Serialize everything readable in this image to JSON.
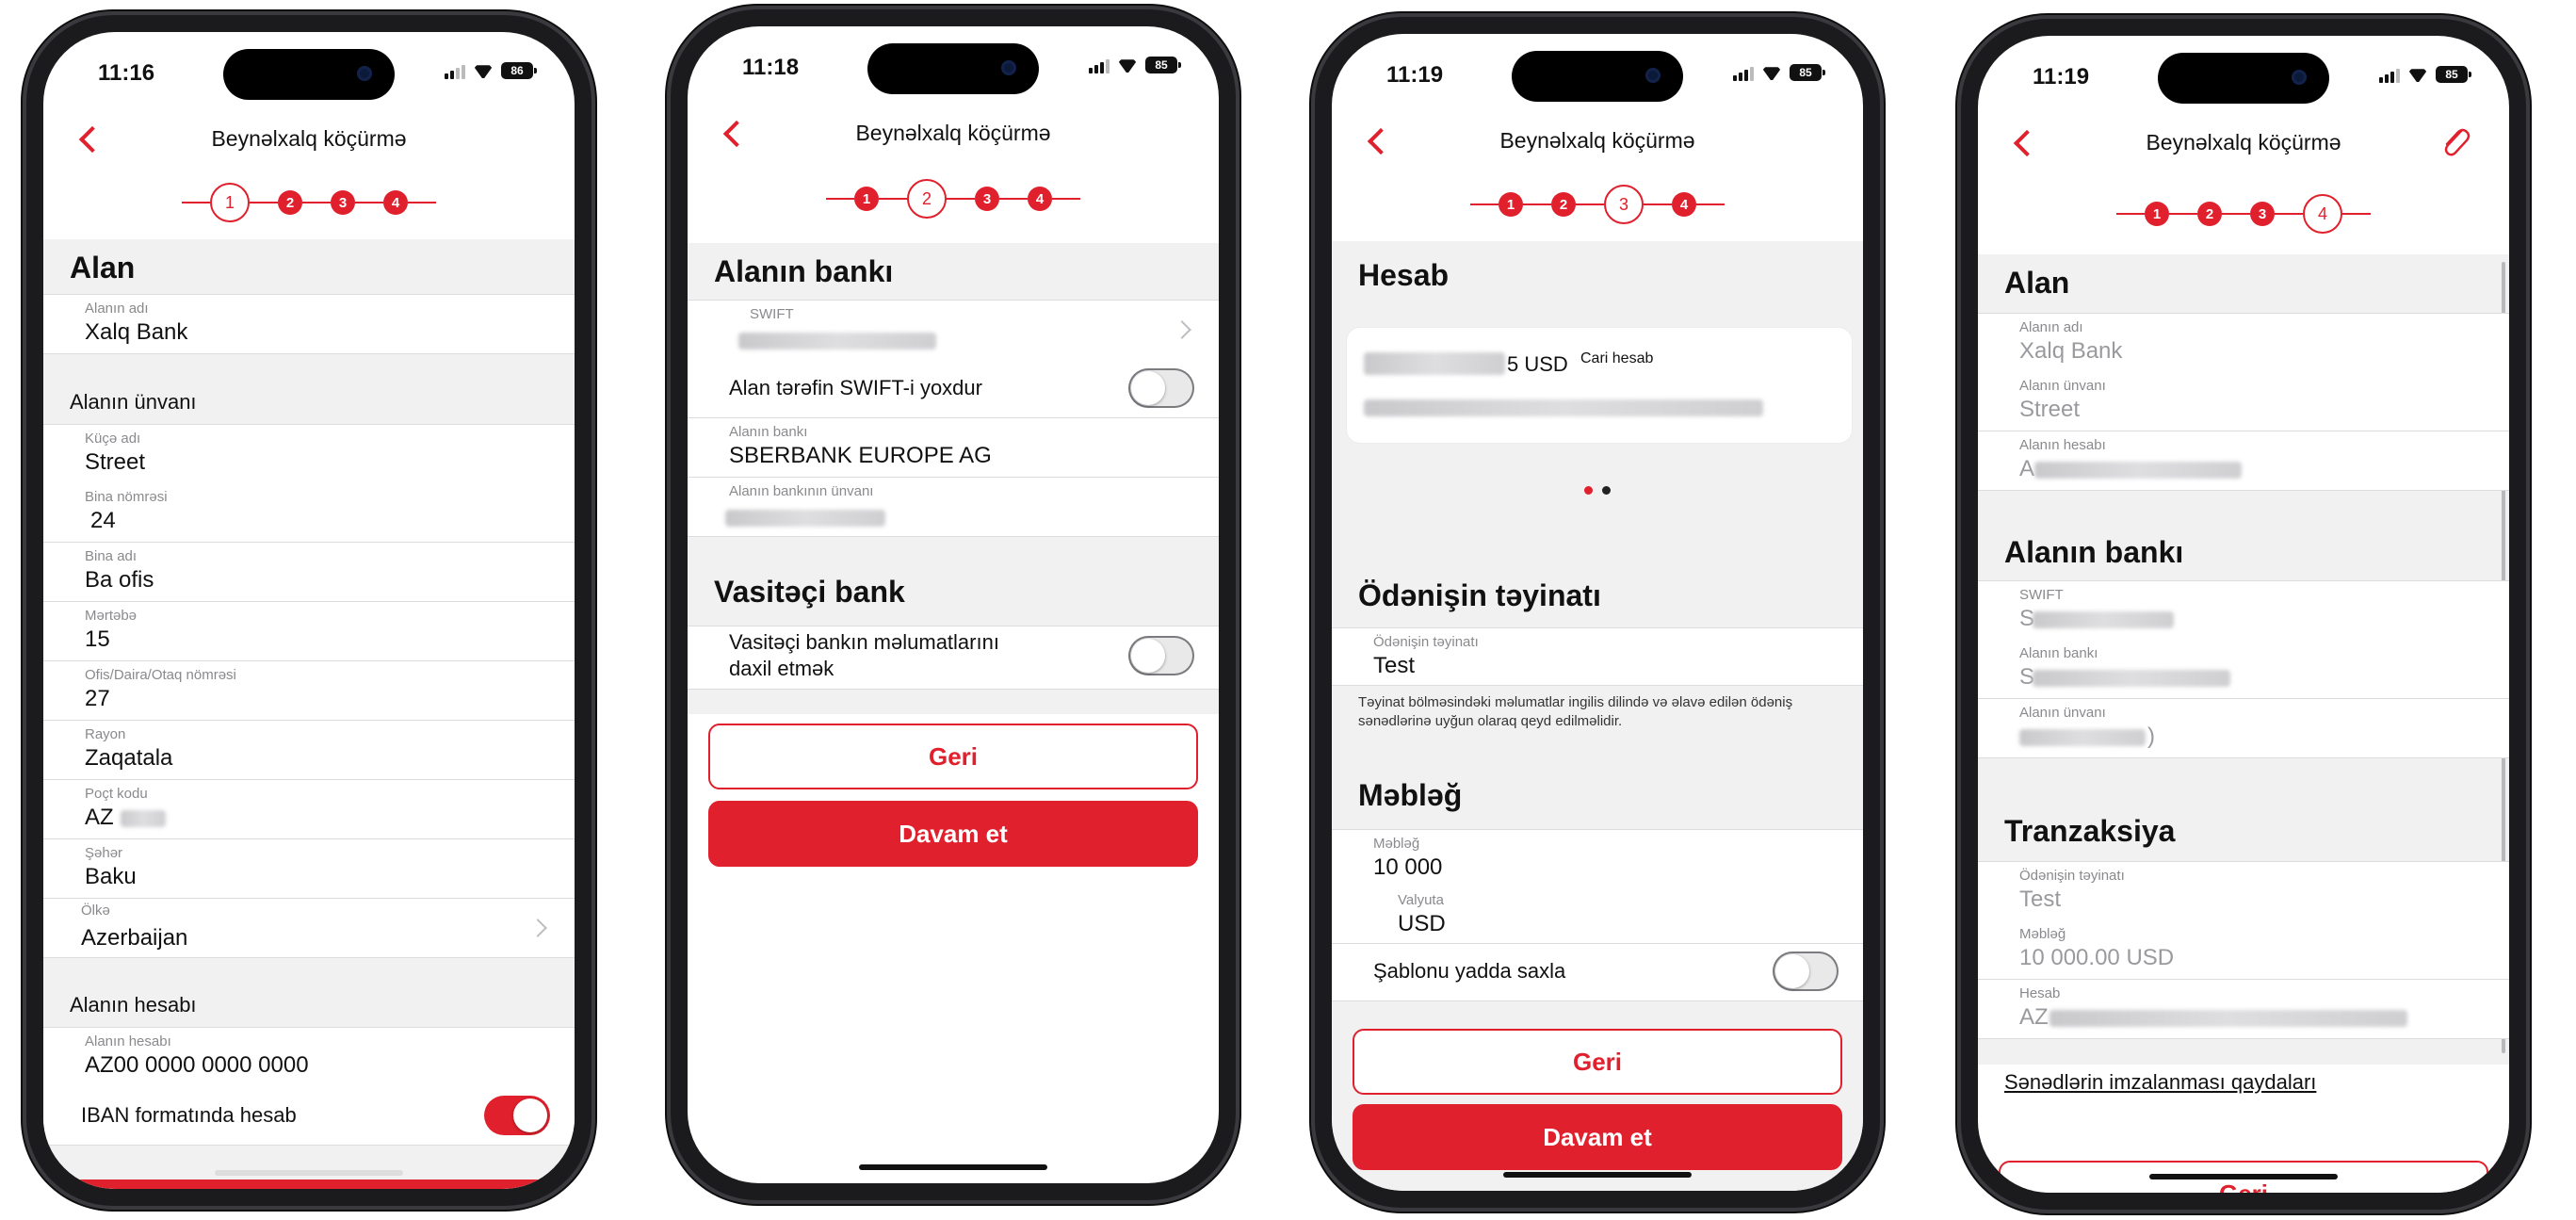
{
  "colors": {
    "accent": "#e0202c"
  },
  "phones": [
    {
      "status": {
        "time": "11:16",
        "battery": "86"
      },
      "nav": {
        "title": "Beynəlxalq köçürmə",
        "back_icon": "chevron-left-icon"
      },
      "steps": [
        "1",
        "2",
        "3",
        "4"
      ],
      "active_step": 1,
      "section_title": "Alan",
      "recipient_name": {
        "label": "Alanın adı",
        "value": "Xalq Bank"
      },
      "address_group": "Alanın ünvanı",
      "address_fields": [
        {
          "label": "Küçə adı",
          "value": "Street"
        },
        {
          "label": "Bina nömrəsi",
          "value": "24"
        },
        {
          "label": "Bina adı",
          "value": "Ba ofis"
        },
        {
          "label": "Mərtəbə",
          "value": "15"
        },
        {
          "label": "Ofis/Daira/Otaq nömrəsi",
          "value": "27"
        },
        {
          "label": "Rayon",
          "value": "Zaqatala"
        },
        {
          "label": "Poçt kodu",
          "value": "AZ"
        },
        {
          "label": "Şəhər",
          "value": "Baku"
        },
        {
          "label": "Ölkə",
          "value": "Azerbaijan"
        }
      ],
      "account_group": "Alanın hesabı",
      "account": {
        "label": "Alanın hesabı",
        "value": "AZ00 0000 0000 0000"
      },
      "iban_toggle": {
        "label": "IBAN formatında hesab",
        "on": true
      }
    },
    {
      "status": {
        "time": "11:18",
        "battery": "85"
      },
      "nav": {
        "title": "Beynəlxalq köçürmə",
        "back_icon": "chevron-left-icon"
      },
      "steps": [
        "1",
        "2",
        "3",
        "4"
      ],
      "active_step": 2,
      "bank_section": "Alanın bankı",
      "swift": {
        "label": "SWIFT"
      },
      "no_swift_toggle": {
        "label": "Alan tərəfin SWIFT-i yoxdur",
        "on": false
      },
      "bank_name": {
        "label": "Alanın bankı",
        "value": "SBERBANK EUROPE AG"
      },
      "bank_address": {
        "label": "Alanın bankının ünvanı"
      },
      "intermediary_section": "Vasitəçi bank",
      "intermediary_toggle": {
        "label_line1": "Vasitəçi bankın məlumatlarını",
        "label_line2": "daxil etmək",
        "on": false
      },
      "back_button": "Geri",
      "continue_button": "Davam et"
    },
    {
      "status": {
        "time": "11:19",
        "battery": "85"
      },
      "nav": {
        "title": "Beynəlxalq köçürmə",
        "back_icon": "chevron-left-icon"
      },
      "steps": [
        "1",
        "2",
        "3",
        "4"
      ],
      "active_step": 3,
      "account_section": "Hesab",
      "account_card": {
        "amount_suffix": "5 USD",
        "type": "Cari hesab"
      },
      "pager": {
        "count": 2,
        "active": 1
      },
      "purpose_section": "Ödənişin təyinatı",
      "purpose": {
        "label": "Ödənişin təyinatı",
        "value": "Test"
      },
      "purpose_note": "Təyinat bölməsindəki məlumatlar ingilis dilində və əlavə edilən ödəniş sənədlərinə uyğun olaraq qeyd edilməlidir.",
      "amount_section": "Məbləğ",
      "amount": {
        "label": "Məbləğ",
        "value": "10 000"
      },
      "currency": {
        "label": "Valyuta",
        "value": "USD"
      },
      "template_toggle": {
        "label": "Şablonu yadda saxla",
        "on": false
      },
      "back_button": "Geri",
      "continue_button": "Davam et"
    },
    {
      "status": {
        "time": "11:19",
        "battery": "85"
      },
      "nav": {
        "title": "Beynəlxalq köçürmə",
        "back_icon": "chevron-left-icon",
        "attach_icon": "paperclip-icon"
      },
      "steps": [
        "1",
        "2",
        "3",
        "4"
      ],
      "active_step": 4,
      "recipient_section": "Alan",
      "recipient_fields": [
        {
          "label": "Alanın adı",
          "value": "Xalq Bank"
        },
        {
          "label": "Alanın ünvanı",
          "value": "Street"
        },
        {
          "label": "Alanın hesabı",
          "value": "A"
        }
      ],
      "bank_section": "Alanın bankı",
      "bank_fields": [
        {
          "label": "SWIFT",
          "value": "S"
        },
        {
          "label": "Alanın bankı",
          "value": "S"
        },
        {
          "label": "Alanın ünvanı",
          "value": ")"
        }
      ],
      "tx_section": "Tranzaksiya",
      "tx_fields": [
        {
          "label": "Ödənişin təyinatı",
          "value": "Test"
        },
        {
          "label": "Məbləğ",
          "value": "10 000.00 USD"
        },
        {
          "label": "Hesab",
          "value": "AZ"
        }
      ],
      "rules_link": "Sənədlərin imzalanması qaydaları",
      "back_button": "Geri"
    }
  ]
}
